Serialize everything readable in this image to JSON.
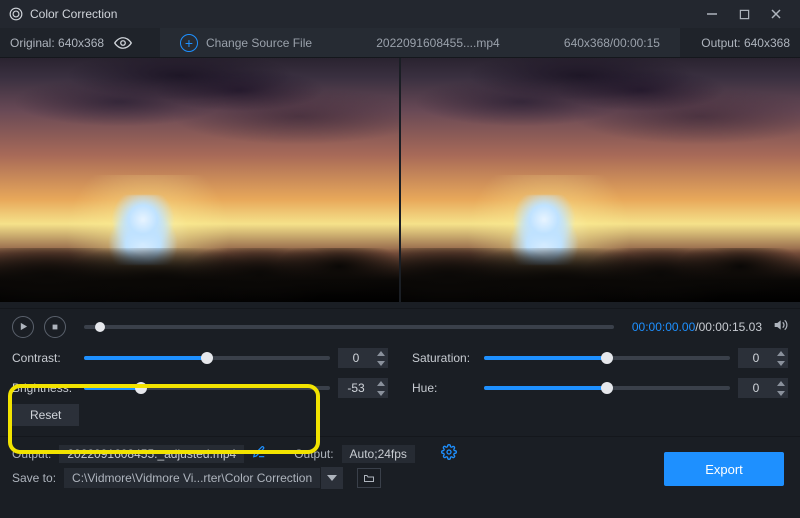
{
  "titlebar": {
    "title": "Color Correction"
  },
  "toolbar": {
    "original_label": "Original:",
    "original_dims": "640x368",
    "change_source_label": "Change Source File",
    "source_filename": "2022091608455....mp4",
    "source_meta": "640x368/00:00:15",
    "output_label": "Output:",
    "output_dims": "640x368"
  },
  "playback": {
    "current_time": "00:00:00.00",
    "total_time": "00:00:15.03"
  },
  "sliders": {
    "contrast": {
      "label": "Contrast:",
      "value": 0,
      "fill_pct": 50,
      "thumb_pct": 50
    },
    "saturation": {
      "label": "Saturation:",
      "value": 0,
      "fill_pct": 50,
      "thumb_pct": 50
    },
    "brightness": {
      "label": "Brightness:",
      "value": -53,
      "fill_pct": 23,
      "thumb_pct": 23
    },
    "hue": {
      "label": "Hue:",
      "value": 0,
      "fill_pct": 50,
      "thumb_pct": 50
    },
    "reset_label": "Reset"
  },
  "output": {
    "label": "Output:",
    "filename": "2022091608455._adjusted.mp4",
    "label2": "Output:",
    "encoding": "Auto;24fps"
  },
  "save": {
    "label": "Save to:",
    "path": "C:\\Vidmore\\Vidmore Vi...rter\\Color Correction"
  },
  "export_label": "Export"
}
